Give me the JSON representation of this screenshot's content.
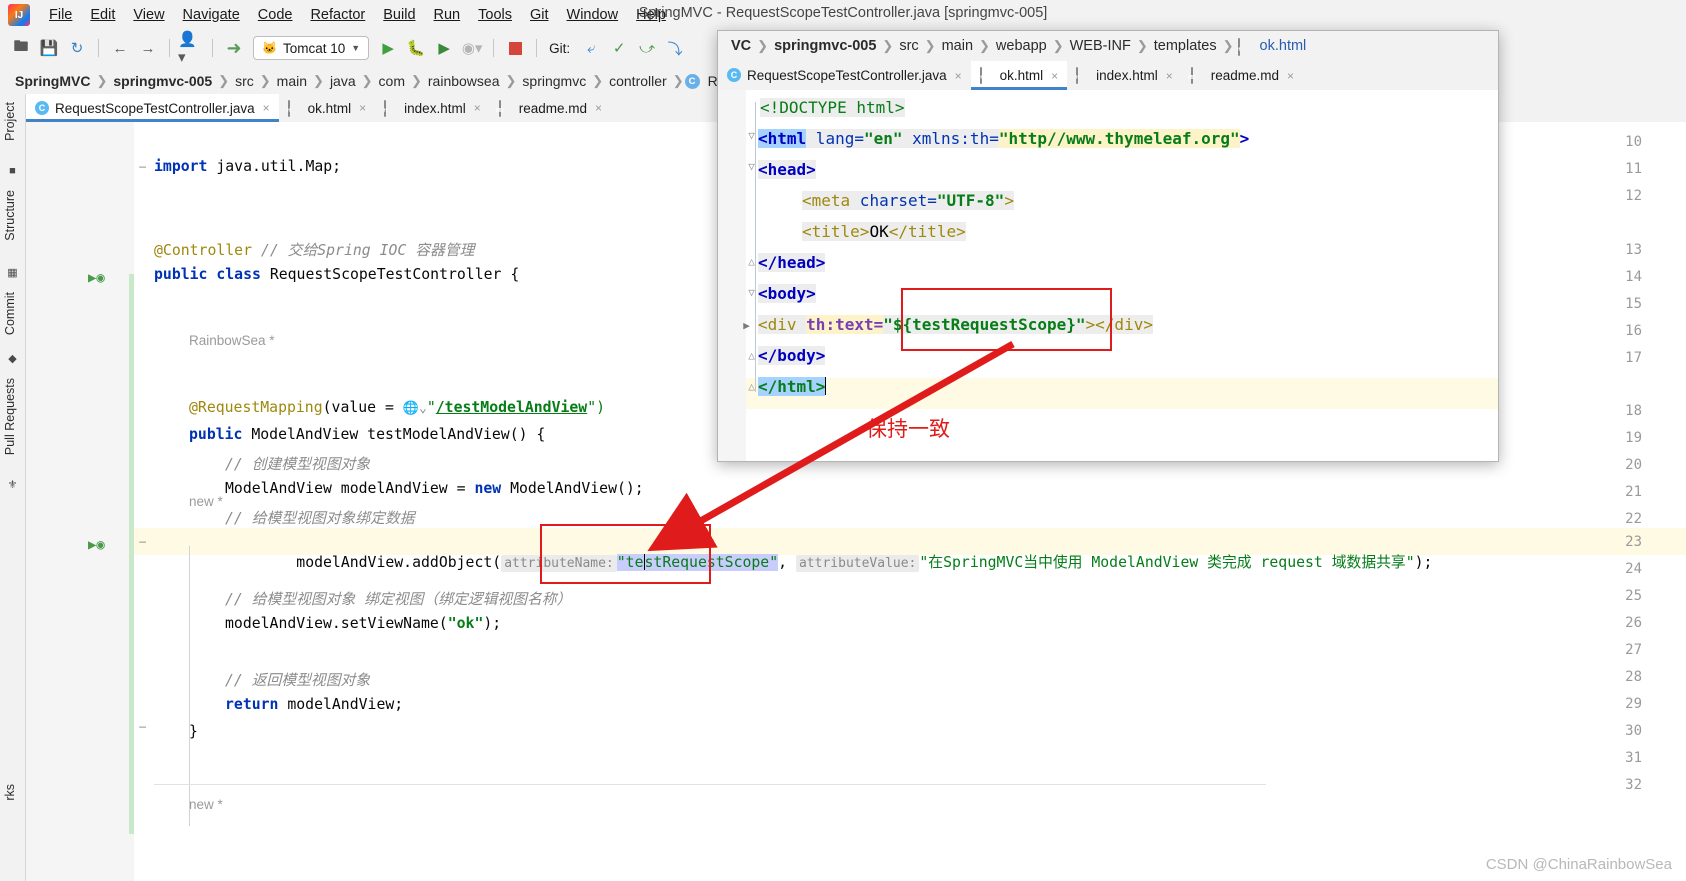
{
  "window": {
    "title": "SpringMVC - RequestScopeTestController.java [springmvc-005]"
  },
  "menubar": {
    "items": [
      {
        "label": "File"
      },
      {
        "label": "Edit"
      },
      {
        "label": "View"
      },
      {
        "label": "Navigate"
      },
      {
        "label": "Code"
      },
      {
        "label": "Refactor"
      },
      {
        "label": "Build"
      },
      {
        "label": "Run"
      },
      {
        "label": "Tools"
      },
      {
        "label": "Git"
      },
      {
        "label": "Window"
      },
      {
        "label": "Help"
      }
    ]
  },
  "toolbar": {
    "open_icon": "open-folder-icon",
    "save_icon": "save-icon",
    "sync_icon": "sync-icon",
    "back_icon": "back-arrow-icon",
    "forward_icon": "forward-arrow-icon",
    "profile_icon": "user-profile-icon",
    "build_icon": "build-hammer-icon",
    "run_config": "Tomcat 10",
    "run_icon": "run-icon",
    "debug_icon": "debug-icon",
    "run_coverage_icon": "run-with-coverage-icon",
    "profiler_icon": "profiler-icon",
    "stop_icon": "stop-icon",
    "git_label": "Git:",
    "git_update_icon": "git-update-icon",
    "git_commit_icon": "git-commit-icon",
    "git_push_icon": "git-push-icon",
    "git_history_icon": "git-history-icon"
  },
  "breadcrumb": {
    "items": [
      "SpringMVC",
      "springmvc-005",
      "src",
      "main",
      "java",
      "com",
      "rainbowsea",
      "springmvc",
      "controller",
      "RequestScopeTestController.java"
    ]
  },
  "left_strip": {
    "project_label": "Project",
    "structure_label": "Structure",
    "commit_label": "Commit",
    "pull_requests_label": "Pull Requests",
    "bookmarks_label": "rks"
  },
  "editor_tabs": [
    {
      "label": "RequestScopeTestController.java",
      "icon": "java-class-icon",
      "active": true,
      "close": "×"
    },
    {
      "label": "ok.html",
      "icon": "html-file-icon",
      "active": false,
      "close": "×"
    },
    {
      "label": "index.html",
      "icon": "html-file-icon",
      "active": false,
      "close": "×"
    },
    {
      "label": "readme.md",
      "icon": "markdown-file-icon",
      "active": false,
      "close": "×"
    }
  ],
  "editor": {
    "lines": [
      {
        "no": "10",
        "segments": []
      },
      {
        "no": "11",
        "segments": [
          {
            "t": "import",
            "c": "kw"
          },
          {
            "t": " java.util.Map;",
            "c": "pln"
          }
        ]
      },
      {
        "no": "12",
        "segments": []
      },
      {
        "no": "",
        "segments": [
          {
            "t": "RainbowSea *",
            "c": "inlay-new"
          }
        ],
        "inlay_author": true
      },
      {
        "no": "13",
        "segments": [
          {
            "t": "@Controller",
            "c": "ann"
          },
          {
            "t": " ",
            "c": "pln"
          },
          {
            "t": "// 交给Spring IOC 容器管理",
            "c": "cmt"
          }
        ]
      },
      {
        "no": "14",
        "segments": [
          {
            "t": "public class",
            "c": "kw"
          },
          {
            "t": " RequestScopeTestController ",
            "c": "pln"
          },
          {
            "t": "{",
            "c": "pln"
          }
        ]
      },
      {
        "no": "15",
        "segments": []
      },
      {
        "no": "16",
        "segments": []
      },
      {
        "no": "17",
        "segments": []
      },
      {
        "no": "",
        "segments": [
          {
            "t": "new *",
            "c": "inlay-new"
          }
        ]
      },
      {
        "no": "18",
        "segments": [
          {
            "t": "@RequestMapping",
            "c": "ann"
          },
          {
            "t": "(value = ",
            "c": "pln"
          },
          {
            "t": "ⓧ⌄",
            "c": "pln"
          },
          {
            "t": "\"",
            "c": "str"
          },
          {
            "t": "/testModelAndView",
            "c": "url-str"
          },
          {
            "t": "\")",
            "c": "str"
          }
        ]
      },
      {
        "no": "19",
        "segments": [
          {
            "t": "public",
            "c": "kw"
          },
          {
            "t": " ModelAndView testModelAndView() {",
            "c": "pln"
          }
        ]
      },
      {
        "no": "20",
        "segments": [
          {
            "t": "// 创建模型视图对象",
            "c": "cmt"
          }
        ]
      },
      {
        "no": "21",
        "segments": [
          {
            "t": "ModelAndView modelAndView = ",
            "c": "pln"
          },
          {
            "t": "new",
            "c": "kw"
          },
          {
            "t": " ModelAndView();",
            "c": "pln"
          }
        ]
      },
      {
        "no": "22",
        "segments": [
          {
            "t": "// 给模型视图对象绑定数据",
            "c": "cmt"
          }
        ]
      },
      {
        "no": "23",
        "segments": [],
        "special": "addObject",
        "highlighted": true
      },
      {
        "no": "24",
        "segments": []
      },
      {
        "no": "25",
        "segments": [
          {
            "t": "// 给模型视图对象 绑定视图（绑定逻辑视图名称）",
            "c": "cmt"
          }
        ]
      },
      {
        "no": "26",
        "segments": [
          {
            "t": "modelAndView.setViewName(",
            "c": "pln"
          },
          {
            "t": "\"ok\"",
            "c": "str"
          },
          {
            "t": ");",
            "c": "pln"
          }
        ]
      },
      {
        "no": "27",
        "segments": []
      },
      {
        "no": "28",
        "segments": [
          {
            "t": "// 返回模型视图对象",
            "c": "cmt"
          }
        ]
      },
      {
        "no": "29",
        "segments": [
          {
            "t": "return",
            "c": "kw"
          },
          {
            "t": " modelAndView;",
            "c": "pln"
          }
        ]
      },
      {
        "no": "30",
        "segments": [
          {
            "t": "}",
            "c": "pln"
          }
        ]
      },
      {
        "no": "31",
        "segments": []
      },
      {
        "no": "32",
        "segments": []
      }
    ],
    "line23": {
      "prefix": "modelAndView.addObject(",
      "hint1": "attributeName:",
      "arg1": "\"testRequestScope\"",
      "comma": ",",
      "hint2": "attributeValue:",
      "arg2": "\"在SpringMVC当中使用 ModelAndView 类完成 request 域数据共享\"",
      "suffix": ");"
    },
    "bottom_inlay": "new *"
  },
  "popup": {
    "breadcrumb": {
      "items": [
        "VC",
        "springmvc-005",
        "src",
        "main",
        "webapp",
        "WEB-INF",
        "templates",
        "ok.html"
      ]
    },
    "tabs": [
      {
        "label": "RequestScopeTestController.java",
        "icon": "java-class-icon",
        "active": false,
        "close": "×"
      },
      {
        "label": "ok.html",
        "icon": "html-file-icon",
        "active": true,
        "close": "×"
      },
      {
        "label": "index.html",
        "icon": "html-file-icon",
        "active": false,
        "close": "×"
      },
      {
        "label": "readme.md",
        "icon": "markdown-file-icon",
        "active": false,
        "close": "×"
      }
    ],
    "code": {
      "l1": "<!DOCTYPE html>",
      "l2_a": "<html",
      "l2_b": " lang=",
      "l2_c": "\"en\"",
      "l2_d": " xmlns:th=",
      "l2_e": "\"http//www.thymeleaf.org\"",
      "l2_f": ">",
      "l3": "<head>",
      "l4_a": "<meta",
      "l4_b": " charset=",
      "l4_c": "\"UTF-8\"",
      "l4_d": ">",
      "l5_a": "<title>",
      "l5_b": "OK",
      "l5_c": "</title>",
      "l6": "</head>",
      "l7": "<body>",
      "l8_a": "<div ",
      "l8_b": "th:text=",
      "l8_c": "\"${testRequestScope}\"",
      "l8_d": "></div>",
      "l9": "</body>",
      "l10": "</html>"
    }
  },
  "annotations": {
    "note_cn": "保持一致",
    "box_color": "#e01b1b",
    "arrow_color": "#e01b1b"
  },
  "watermark": "CSDN @ChinaRainbowSea"
}
